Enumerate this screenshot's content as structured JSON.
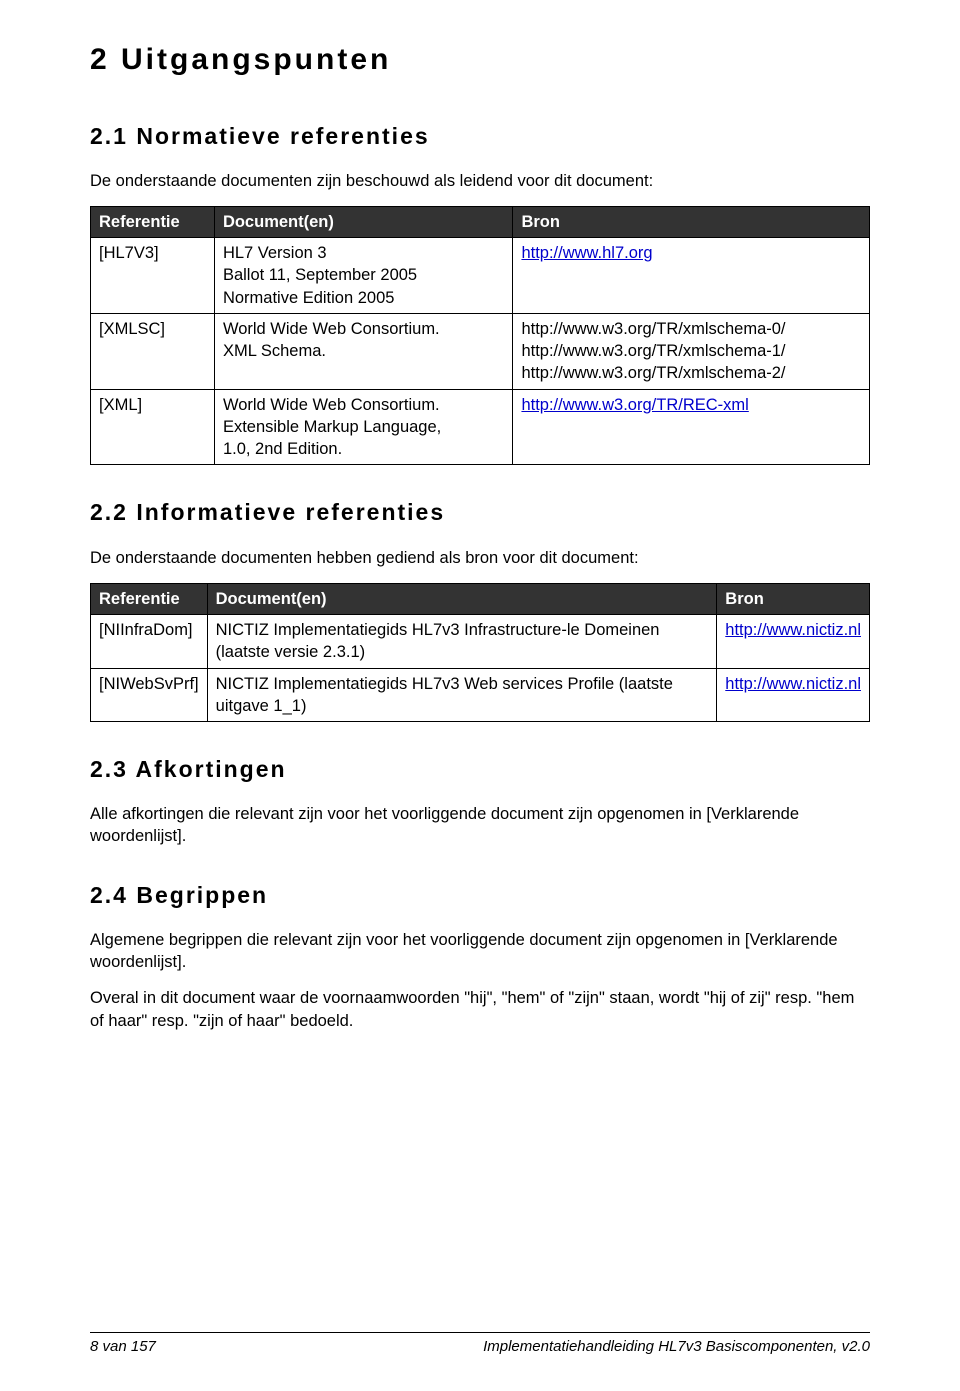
{
  "headings": {
    "h1": "2   Uitgangspunten",
    "s21": "2.1   Normatieve referenties",
    "s22": "2.2   Informatieve referenties",
    "s23": "2.3   Afkortingen",
    "s24": "2.4   Begrippen"
  },
  "intro21": "De onderstaande documenten zijn beschouwd als leidend voor dit document:",
  "intro22": "De onderstaande documenten hebben gediend als bron voor dit document:",
  "text23": "Alle afkortingen die relevant zijn voor het voorliggende document zijn opgenomen in [Verklarende woordenlijst].",
  "text24a": "Algemene begrippen die relevant zijn voor het voorliggende document zijn opgenomen in [Verklarende woordenlijst].",
  "text24b": "Overal in dit document waar de voornaamwoorden \"hij\", \"hem\" of \"zijn\" staan, wordt \"hij of zij\" resp. \"hem of haar\" resp. \"zijn of haar\" bedoeld.",
  "table_headers": {
    "ref": "Referentie",
    "doc": "Document(en)",
    "bron": "Bron"
  },
  "table1": {
    "r0": {
      "ref": "[HL7V3]",
      "doc": "HL7 Version 3\nBallot 11, September 2005\nNormative Edition 2005",
      "bron_href": "http://www.hl7.org",
      "bron_text": "http://www.hl7.org"
    },
    "r1": {
      "ref": "[XMLSC]",
      "doc": "World Wide Web Consortium.\nXML Schema.",
      "bron_lines": {
        "l0": "http://www.w3.org/TR/xmlschema-0/",
        "l1": "http://www.w3.org/TR/xmlschema-1/",
        "l2": "http://www.w3.org/TR/xmlschema-2/"
      }
    },
    "r2": {
      "ref": "[XML]",
      "doc": "World Wide Web Consortium.\nExtensible Markup Language,\n1.0, 2nd Edition.",
      "bron_href": "http://www.w3.org/TR/REC-xml",
      "bron_text": "http://www.w3.org/TR/REC-xml"
    }
  },
  "table2": {
    "r0": {
      "ref": "[NIInfraDom]",
      "doc": "NICTIZ Implementatiegids HL7v3 Infrastructure-le Domeinen (laatste versie 2.3.1)",
      "bron_href": "http://www.nictiz.nl",
      "bron_text": "http://www.nictiz.nl"
    },
    "r1": {
      "ref": "[NIWebSvPrf]",
      "doc": "NICTIZ Implementatiegids HL7v3 Web services Profile (laatste uitgave 1_1)",
      "bron_href": "http://www.nictiz.nl",
      "bron_text": "http://www.nictiz.nl"
    }
  },
  "footer": {
    "left": "8 van 157",
    "right": "Implementatiehandleiding HL7v3 Basiscomponenten, v2.0"
  }
}
